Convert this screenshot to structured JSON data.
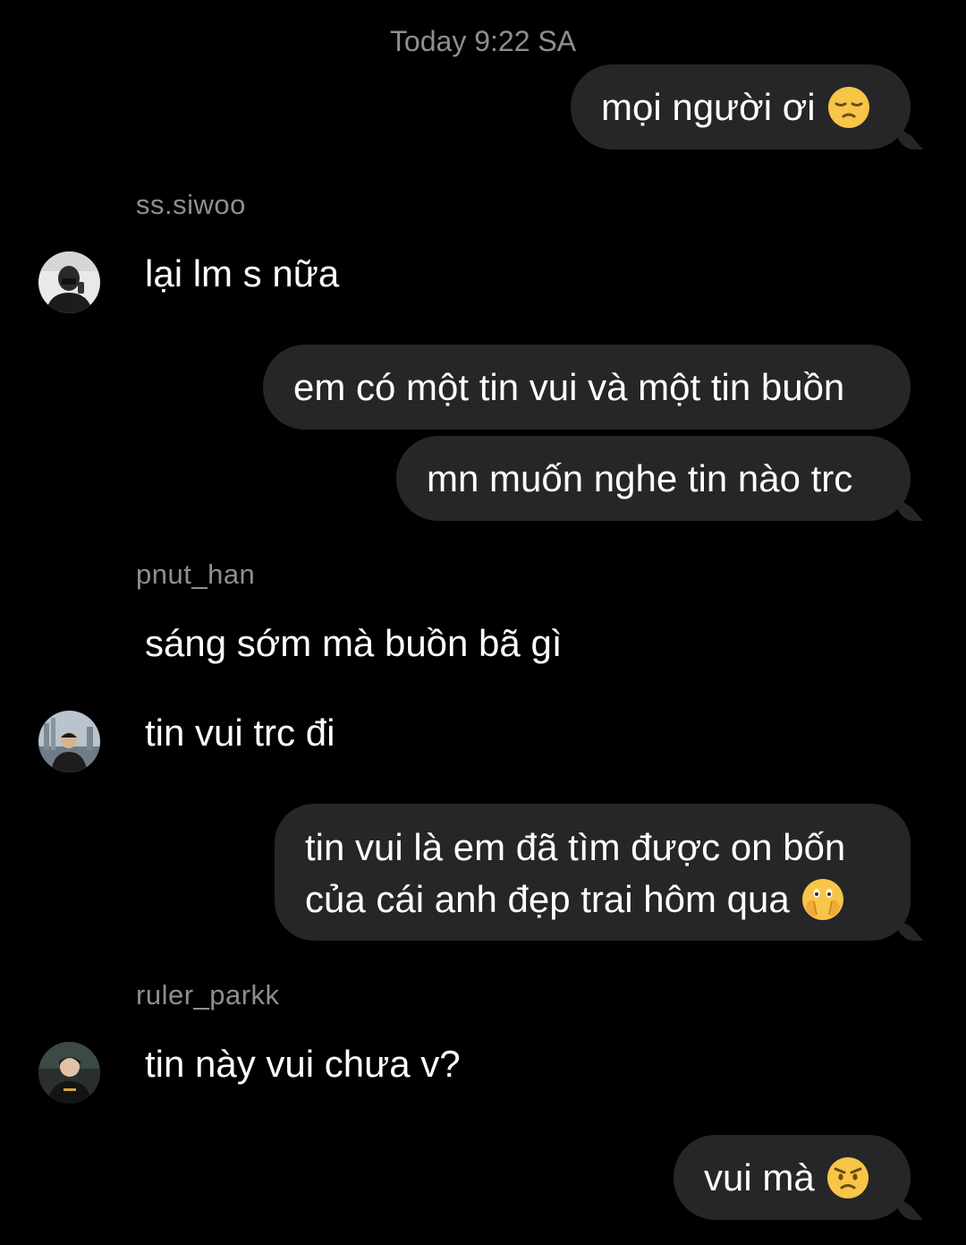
{
  "header": {
    "timestamp": "Today 9:22 SA"
  },
  "messages": [
    {
      "direction": "outgoing",
      "text": "mọi người ơi",
      "emoji": "pensive-face-icon"
    },
    {
      "direction": "incoming",
      "sender": "ss.siwoo",
      "avatar": "avatar-ss-siwoo",
      "text": "lại lm s nữa"
    },
    {
      "direction": "outgoing",
      "text": "em có một tin vui và một tin buồn"
    },
    {
      "direction": "outgoing",
      "text": "mn muốn nghe tin nào trc"
    },
    {
      "direction": "incoming",
      "sender": "pnut_han",
      "text": "sáng sớm mà buồn bã gì"
    },
    {
      "direction": "incoming",
      "avatar": "avatar-pnut-han",
      "text": "tin vui trc đi"
    },
    {
      "direction": "outgoing",
      "text_line1": "tin vui là em đã tìm được on bốn",
      "text_line2": "của cái anh đẹp trai hôm qua",
      "emoji": "face-with-open-eyes-and-hand-over-mouth-icon"
    },
    {
      "direction": "incoming",
      "sender": "ruler_parkk",
      "avatar": "avatar-ruler-parkk",
      "text": "tin này vui chưa v?"
    },
    {
      "direction": "outgoing",
      "text": "vui mà",
      "emoji": "angry-face-icon"
    }
  ],
  "colors": {
    "background": "#000000",
    "outgoing_bubble": "#262628",
    "text": "#ffffff",
    "secondary_text": "#8e8e93",
    "emoji_yellow": "#f7c548"
  }
}
